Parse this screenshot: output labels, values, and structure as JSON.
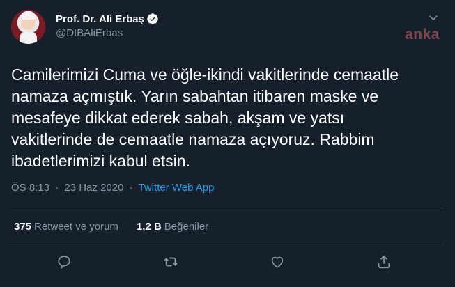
{
  "user": {
    "display_name": "Prof. Dr. Ali Erbaş",
    "handle": "@DIBAliErbas",
    "verified": true
  },
  "watermark": "anka",
  "tweet": {
    "text": "Camilerimizi Cuma ve öğle-ikindi vakitlerinde cemaatle\nnamaza açmıştık. Yarın sabahtan itibaren maske ve\nmesafeye dikkat ederek sabah, akşam ve yatsı\nvakitlerinde de cemaatle namaza açıyoruz. Rabbim\nibadetlerimizi kabul etsin.",
    "time": "ÖS 8:13",
    "separator": "·",
    "date": "23 Haz 2020",
    "separator2": "·",
    "source": "Twitter Web App"
  },
  "stats": {
    "retweets_count": "375",
    "retweets_label": "Retweet ve yorum",
    "likes_count": "1,2 B",
    "likes_label": "Beğeniler"
  },
  "icons": {
    "reply": "reply-icon",
    "retweet": "retweet-icon",
    "like": "heart-icon",
    "share": "share-icon",
    "more": "chevron-down-icon",
    "verified": "verified-badge-icon"
  },
  "colors": {
    "background": "#15202b",
    "accent": "#1da1f2",
    "secondary_text": "#8899a6",
    "divider": "#38444d"
  }
}
